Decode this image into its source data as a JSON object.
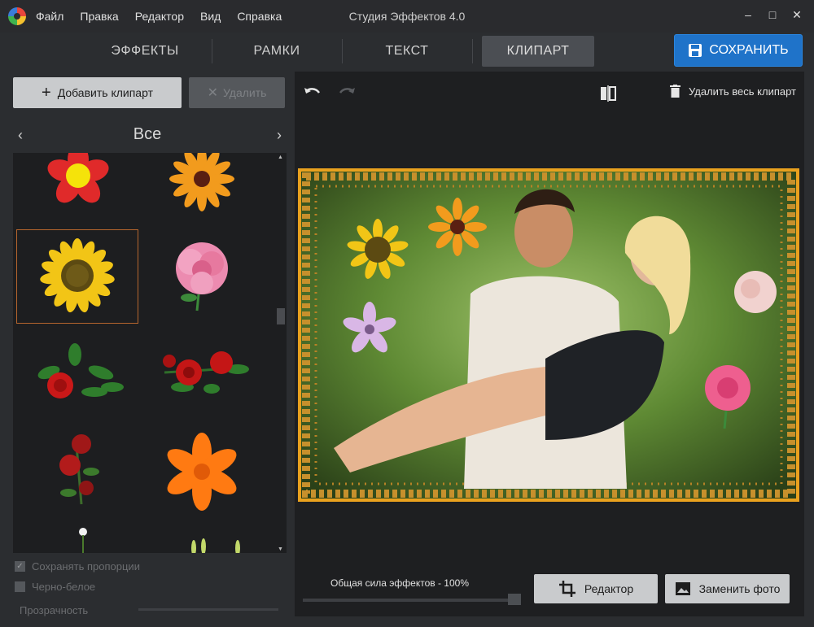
{
  "app": {
    "title": "Студия Эффектов 4.0",
    "logo_icon": "app-logo-icon"
  },
  "menu": [
    "Файл",
    "Правка",
    "Редактор",
    "Вид",
    "Справка"
  ],
  "window_controls": {
    "minimize": "–",
    "maximize": "□",
    "close": "✕"
  },
  "tabs": [
    {
      "label": "ЭФФЕКТЫ",
      "active": false
    },
    {
      "label": "РАМКИ",
      "active": false
    },
    {
      "label": "ТЕКСТ",
      "active": false
    },
    {
      "label": "КЛИПАРТ",
      "active": true
    }
  ],
  "save": {
    "label": "СОХРАНИТЬ",
    "icon": "floppy-disk-icon",
    "color": "#1f73c9"
  },
  "clipart_panel": {
    "add_label": "Добавить клипарт",
    "delete_label": "Удалить",
    "category": "Все",
    "prev_arrow": "‹",
    "next_arrow": "›",
    "items": [
      "red-flower-clipart",
      "orange-daisy-clipart",
      "sunflower-clipart",
      "pink-rose-clipart",
      "red-roses-branch-clipart",
      "red-roses-bouquet-clipart",
      "small-red-roses-clipart",
      "orange-lily-clipart",
      "white-bud-clipart",
      "green-sprout-clipart"
    ],
    "selected_index": 2,
    "keep_proportions_label": "Сохранять пропорции",
    "keep_proportions_checked": true,
    "black_white_label": "Черно-белое",
    "black_white_checked": false,
    "opacity_label": "Прозрачность"
  },
  "canvas": {
    "undo_icon": "undo-icon",
    "redo_icon": "redo-icon",
    "flip_icon": "flip-icon",
    "delete_all_label": "Удалить весь клипарт",
    "frame_color": "#e9a11e",
    "effect_strength_label": "Общая сила эффектов - 100%",
    "effect_strength": 1.0,
    "editor_label": "Редактор",
    "replace_label": "Заменить фото"
  }
}
